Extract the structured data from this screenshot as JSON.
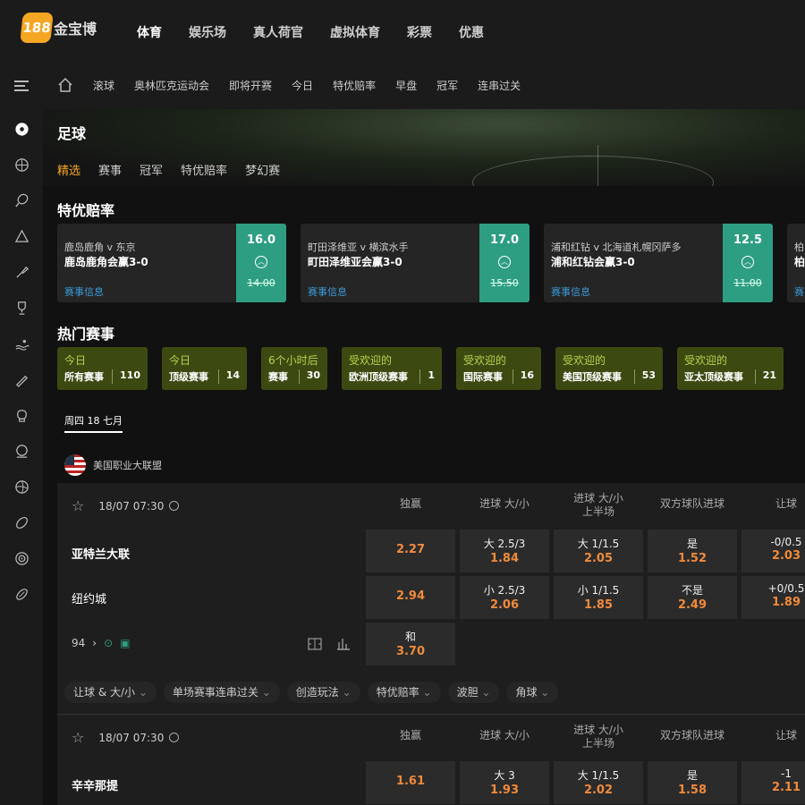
{
  "logo": {
    "badge": "188",
    "text": "金宝博"
  },
  "topnav": [
    "体育",
    "娱乐场",
    "真人荷官",
    "虚拟体育",
    "彩票",
    "优惠"
  ],
  "subnav": [
    "滚球",
    "奥林匹克运动会",
    "即将开赛",
    "今日",
    "特优赔率",
    "早盘",
    "冠军",
    "连串过关"
  ],
  "hero": {
    "title": "足球",
    "tabs": [
      "精选",
      "赛事",
      "冠军",
      "特优赔率",
      "梦幻赛"
    ]
  },
  "specials_title": "特优赔率",
  "specials": [
    {
      "match": "鹿岛鹿角 v 东京",
      "bet": "鹿岛鹿角会赢3-0",
      "info": "赛事信息",
      "new": "16.0",
      "old": "14.00"
    },
    {
      "match": "町田泽维亚 v 横滨水手",
      "bet": "町田泽维亚会赢3-0",
      "info": "赛事信息",
      "new": "17.0",
      "old": "15.50"
    },
    {
      "match": "浦和红钻 v 北海道札幌冈萨多",
      "bet": "浦和红钻会赢3-0",
      "info": "赛事信息",
      "new": "12.5",
      "old": "11.00"
    },
    {
      "match": "柏",
      "bet": "柏",
      "info": "赛",
      "new": "",
      "old": ""
    }
  ],
  "hot_title": "热门赛事",
  "hot": [
    {
      "top": "今日",
      "label": "所有赛事",
      "count": "110"
    },
    {
      "top": "今日",
      "label": "顶级赛事",
      "count": "14"
    },
    {
      "top": "6个小时后",
      "label": "赛事",
      "count": "30"
    },
    {
      "top": "受欢迎的",
      "label": "欧洲顶级赛事",
      "count": "1"
    },
    {
      "top": "受欢迎的",
      "label": "国际赛事",
      "count": "16"
    },
    {
      "top": "受欢迎的",
      "label": "美国顶级赛事",
      "count": "53"
    },
    {
      "top": "受欢迎的",
      "label": "亚太顶级赛事",
      "count": "21"
    }
  ],
  "date": "周四 18 七月",
  "league": "美国职业大联盟",
  "columns": [
    "独赢",
    "进球 大/小",
    "进球 大/小\n上半场",
    "双方球队进球",
    "让球"
  ],
  "match1": {
    "time": "18/07 07:30",
    "home": "亚特兰大联",
    "away": "纽约城",
    "more": "94",
    "h": [
      [
        "",
        "2.27"
      ],
      [
        "大 2.5/3",
        "1.84"
      ],
      [
        "大 1/1.5",
        "2.05"
      ],
      [
        "是",
        "1.52"
      ],
      [
        "-0/0.5",
        "2.03"
      ]
    ],
    "a": [
      [
        "",
        "2.94"
      ],
      [
        "小 2.5/3",
        "2.06"
      ],
      [
        "小 1/1.5",
        "1.85"
      ],
      [
        "不是",
        "2.49"
      ],
      [
        "+0/0.5",
        "1.89"
      ]
    ],
    "draw": [
      "和",
      "3.70"
    ],
    "chips": [
      "让球 & 大/小",
      "单场赛事连串过关",
      "创造玩法",
      "特优赔率",
      "波胆",
      "角球"
    ]
  },
  "match2": {
    "time": "18/07 07:30",
    "home": "辛辛那提",
    "h": [
      [
        "",
        "1.61"
      ],
      [
        "大 3",
        "1.93"
      ],
      [
        "大 1/1.5",
        "2.02"
      ],
      [
        "是",
        "1.58"
      ],
      [
        "-1",
        "2.11"
      ]
    ]
  }
}
